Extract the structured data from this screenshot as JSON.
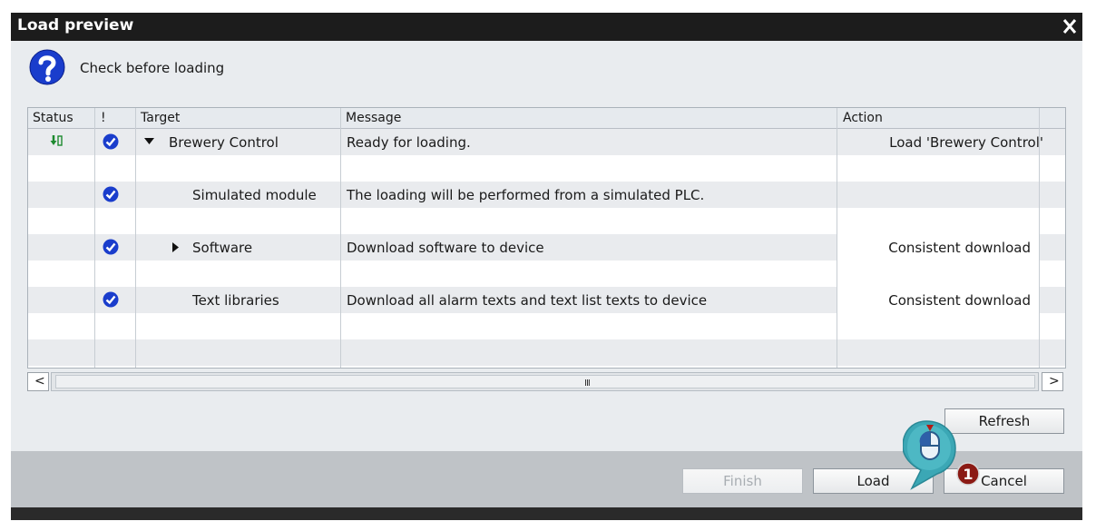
{
  "window": {
    "title": "Load preview"
  },
  "header": {
    "icon": "question-icon",
    "text": "Check before loading"
  },
  "table": {
    "columns": {
      "status": "Status",
      "flag": "!",
      "target": "Target",
      "message": "Message",
      "action": "Action"
    },
    "rows": [
      {
        "target": "Brewery Control",
        "message": "Ready for loading.",
        "action": "Load 'Brewery Control'"
      },
      {
        "target": "Simulated module",
        "message": "The loading will be performed from a simulated PLC.",
        "action": ""
      },
      {
        "target": "Software",
        "message": "Download software to device",
        "action": "Consistent download"
      },
      {
        "target": "Text libraries",
        "message": "Download all alarm texts and text list texts to device",
        "action": "Consistent download"
      }
    ]
  },
  "scrollbar": {
    "left": "<",
    "right": ">",
    "grip": "III"
  },
  "buttons": {
    "refresh": "Refresh",
    "finish": "Finish",
    "load": "Load",
    "cancel": "Cancel"
  },
  "callout": {
    "number": "1"
  },
  "colors": {
    "accent": "#1a3dcc",
    "check": "#1a3dcc",
    "callout": "#3ba7b5",
    "badge": "#8b1a14"
  }
}
